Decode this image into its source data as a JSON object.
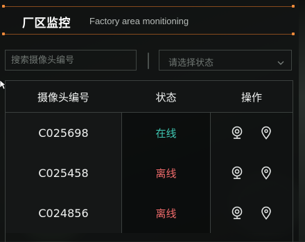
{
  "header": {
    "title": "厂区监控",
    "subtitle": "Factory area monitioning"
  },
  "filters": {
    "search_placeholder": "搜索摄像头编号",
    "status_placeholder": "请选择状态"
  },
  "table": {
    "columns": [
      "摄像头编号",
      "状态",
      "操作"
    ],
    "rows": [
      {
        "id": "C025698",
        "status": "在线",
        "status_color": "#3fc7b3"
      },
      {
        "id": "C025458",
        "status": "离线",
        "status_color": "#f06b6b"
      },
      {
        "id": "C024856",
        "status": "离线",
        "status_color": "#f06b6b"
      }
    ],
    "row_actions": [
      "camera-icon",
      "location-pin-icon"
    ]
  },
  "colors": {
    "accent_orange": "#f08a3a",
    "online": "#3fc7b3",
    "offline": "#f06b6b"
  }
}
